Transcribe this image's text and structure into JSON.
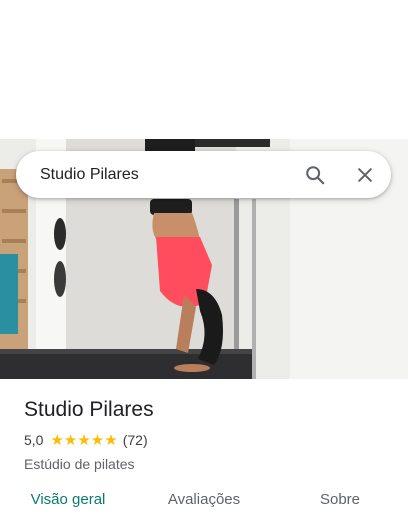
{
  "search": {
    "value": "Studio Pilares"
  },
  "place": {
    "name": "Studio Pilares",
    "rating": "5,0",
    "stars": "★★★★★",
    "review_count": "(72)",
    "category": "Estúdio de pilates"
  },
  "tabs": [
    {
      "label": "Visão geral",
      "active": true
    },
    {
      "label": "Avaliações",
      "active": false
    },
    {
      "label": "Sobre",
      "active": false
    }
  ],
  "colors": {
    "accent": "#0a7a6e",
    "star": "#fbbc04",
    "shorts": "#ff4d5e"
  },
  "icons": {
    "search": "search-icon",
    "close": "close-icon"
  }
}
